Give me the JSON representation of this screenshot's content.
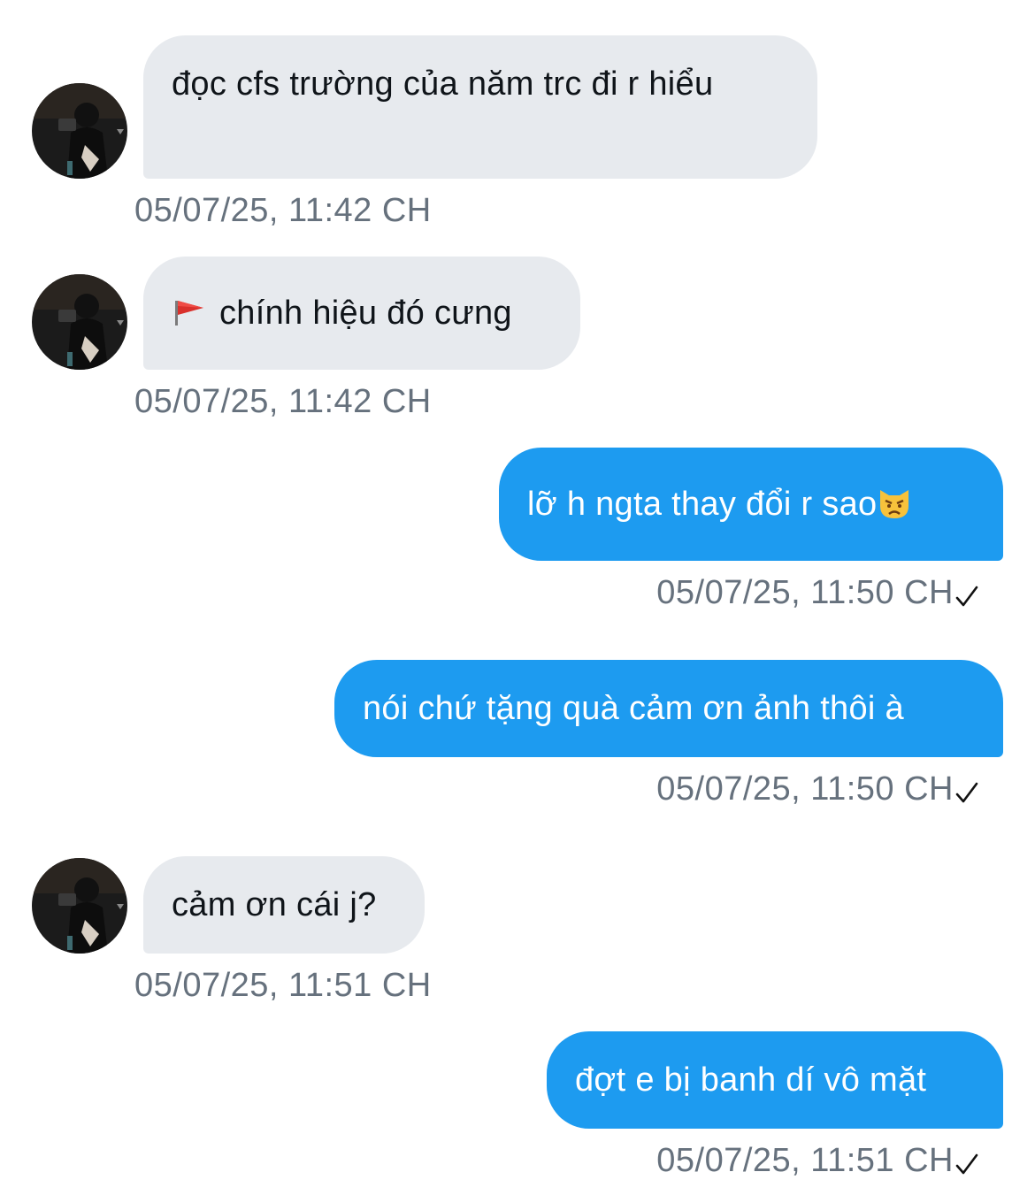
{
  "messages": [
    {
      "side": "in",
      "text": "đọc cfs trường của năm trc đi r hiểu",
      "time": "05/07/25, 11:42 CH"
    },
    {
      "side": "in",
      "icon": "red-flag-icon",
      "text": "chính hiệu đó cưng",
      "time": "05/07/25, 11:42 CH"
    },
    {
      "side": "out",
      "text": "lỡ h ngta thay đổi r sao",
      "icon": "pouting-cat-icon",
      "time": "05/07/25, 11:50 CH",
      "status_icon": "checkmark-icon"
    },
    {
      "side": "out",
      "text": "nói chứ tặng quà cảm ơn ảnh thôi à",
      "time": "05/07/25, 11:50 CH",
      "status_icon": "checkmark-icon"
    },
    {
      "side": "in",
      "text": "cảm ơn cái j?",
      "time": "05/07/25, 11:51 CH"
    },
    {
      "side": "out",
      "text": "đợt e bị banh dí vô mặt",
      "time": "05/07/25, 11:51 CH",
      "status_icon": "checkmark-icon"
    }
  ],
  "colors": {
    "outgoing_bubble": "#1d9bf0",
    "incoming_bubble": "#e7eaee",
    "timestamp": "#66717d",
    "text_dark": "#0f1419"
  }
}
